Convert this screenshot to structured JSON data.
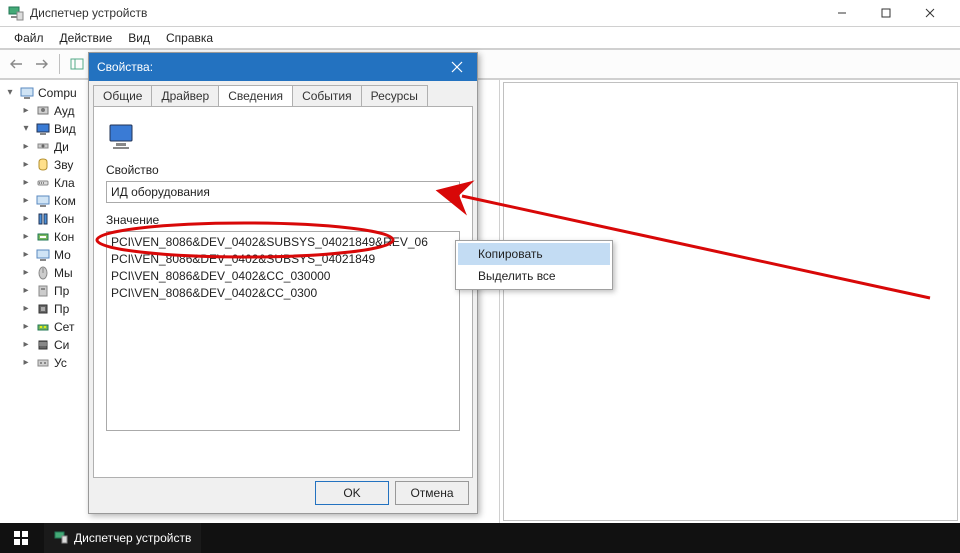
{
  "window": {
    "title": "Диспетчер устройств",
    "icons": {
      "app": "device-manager-icon"
    }
  },
  "menu": [
    "Файл",
    "Действие",
    "Вид",
    "Справка"
  ],
  "tree": {
    "root": "Compu",
    "items": [
      "Ауд",
      "Вид",
      "Ди",
      "Зву",
      "Кла",
      "Ком",
      "Кон",
      "Кон",
      "Мо",
      "Мы",
      "Пр",
      "Пр",
      "Сет",
      "Си",
      "Ус"
    ]
  },
  "dialog": {
    "title": "Свойства:",
    "tabs": [
      "Общие",
      "Драйвер",
      "Сведения",
      "События",
      "Ресурсы"
    ],
    "active_tab": "Сведения",
    "property_label": "Свойство",
    "combo_value": "ИД оборудования",
    "value_label": "Значение",
    "list": [
      "PCI\\VEN_8086&DEV_0402&SUBSYS_04021849&REV_06",
      "PCI\\VEN_8086&DEV_0402&SUBSYS_04021849",
      "PCI\\VEN_8086&DEV_0402&CC_030000",
      "PCI\\VEN_8086&DEV_0402&CC_0300"
    ],
    "ok": "OK",
    "cancel": "Отмена"
  },
  "context_menu": {
    "items": [
      "Копировать",
      "Выделить все"
    ],
    "hover_index": 0
  },
  "taskbar": {
    "app": "Диспетчер устройств"
  }
}
